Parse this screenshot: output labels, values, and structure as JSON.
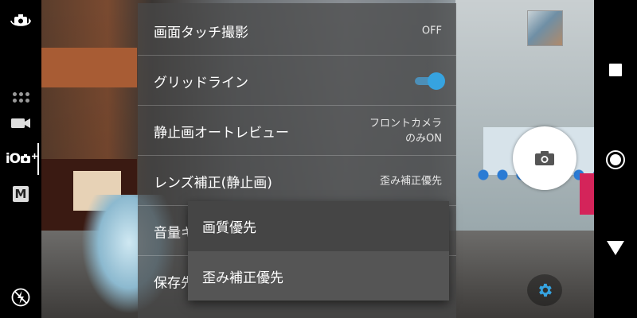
{
  "menu": {
    "rows": [
      {
        "label": "画面タッチ撮影",
        "value": "OFF"
      },
      {
        "label": "グリッドライン",
        "toggle": "on"
      },
      {
        "label": "静止画オートレビュー",
        "value_line1": "フロントカメラ",
        "value_line2": "のみON"
      },
      {
        "label": "レンズ補正(静止画)",
        "value": "歪み補正優先"
      },
      {
        "label": "音量キ"
      },
      {
        "label": "保存先"
      }
    ]
  },
  "dropdown": {
    "options": [
      "画質優先",
      "歪み補正優先"
    ],
    "selected": "歪み補正優先"
  },
  "left_rail": {
    "icons": [
      "switch-camera-icon",
      "more-modes-icon",
      "video-mode-icon",
      "photo-mode-icon",
      "manual-mode-icon",
      "flash-auto-icon"
    ],
    "manual_label": "M",
    "photo_mode_label": "iO"
  },
  "right_rail": {
    "icons": [
      "recent-apps-icon",
      "home-icon",
      "back-icon"
    ]
  },
  "colors": {
    "accent": "#36a3e0",
    "menu_bg": "#484848"
  }
}
